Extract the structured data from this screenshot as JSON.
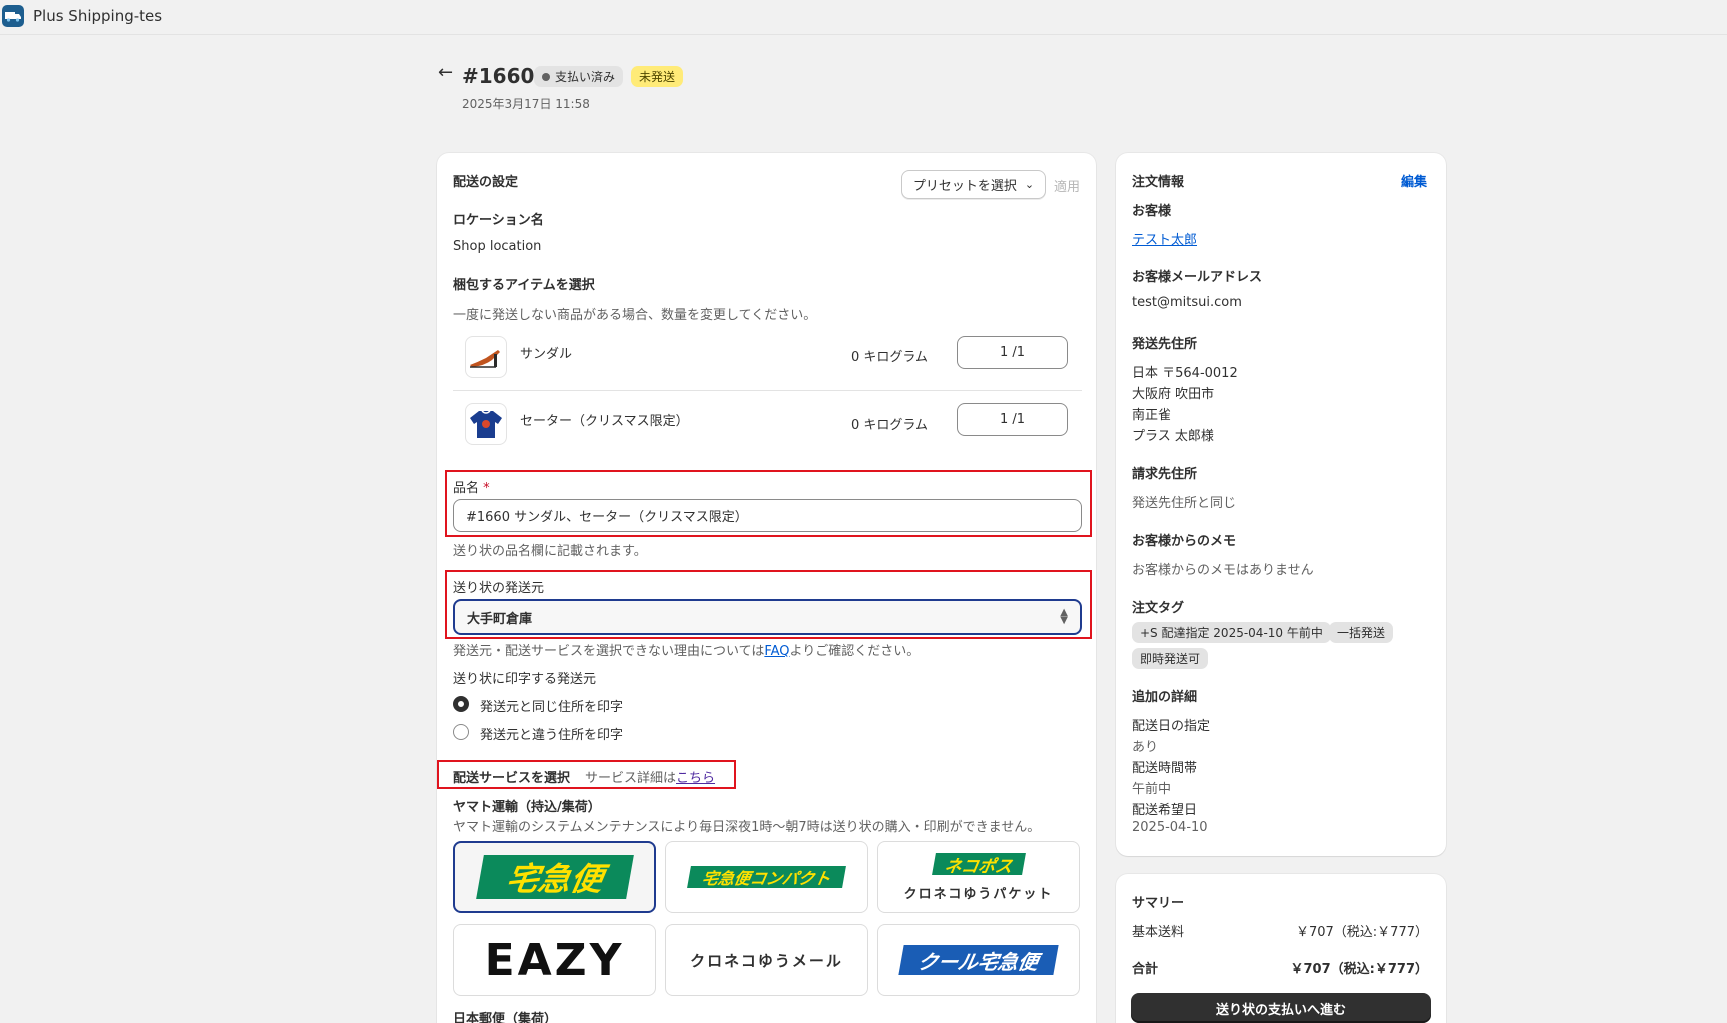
{
  "app": {
    "name": "Plus Shipping-tes"
  },
  "header": {
    "order_number": "#1660",
    "status_paid": "支払い済み",
    "status_fulfillment": "未発送",
    "date": "2025年3月17日 11:58"
  },
  "shipping": {
    "title": "配送の設定",
    "preset_label": "プリセットを選択",
    "apply_label": "適用",
    "location_heading": "ロケーション名",
    "location_value": "Shop location",
    "items_heading": "梱包するアイテムを選択",
    "items_help": "一度に発送しない商品がある場合、数量を変更してください。",
    "items": [
      {
        "name": "サンダル",
        "weight": "0 キログラム",
        "qty": "1 /1"
      },
      {
        "name": "セーター（クリスマス限定）",
        "weight": "0 キログラム",
        "qty": "1 /1"
      }
    ],
    "product_name_label": "品名",
    "product_name_required": "*",
    "product_name_value": "#1660 サンダル、セーター（クリスマス限定）",
    "product_name_help": "送り状の品名欄に記載されます。",
    "origin_label": "送り状の発送元",
    "origin_value": "大手町倉庫",
    "origin_help_before": "発送元・配送サービスを選択できない理由については",
    "origin_help_link": "FAQ",
    "origin_help_after": "よりご確認ください。",
    "print_origin_heading": "送り状に印字する発送元",
    "print_origin_options": [
      "発送元と同じ住所を印字",
      "発送元と違う住所を印字"
    ],
    "service_heading": "配送サービスを選択",
    "service_detail_text": "サービス詳細は",
    "service_detail_link": "こちら",
    "yamato_heading": "ヤマト運輸（持込/集荷）",
    "yamato_notice": "ヤマト運輸のシステムメンテナンスにより毎日深夜1時〜朝7時は送り状の購入・印刷ができません。",
    "services": {
      "takkyubin": "宅急便",
      "compact": "宅急便コンパクト",
      "nekopos": "ネコポス",
      "nekopos_sub": "クロネコゆうパケット",
      "eazy": "EAZY",
      "yu_mail": "クロネコゆうメール",
      "cool": "クール宅急便"
    },
    "japanpost_heading": "日本郵便（集荷）"
  },
  "order_info": {
    "title": "注文情報",
    "edit_label": "編集",
    "customer_heading": "お客様",
    "customer_name": "テスト太郎",
    "email_heading": "お客様メールアドレス",
    "email": "test@mitsui.com",
    "ship_address_heading": "発送先住所",
    "ship_address": [
      "日本 〒564-0012",
      "大阪府 吹田市",
      "南正雀",
      "プラス 太郎様"
    ],
    "billing_heading": "請求先住所",
    "billing_value": "発送先住所と同じ",
    "memo_heading": "お客様からのメモ",
    "memo_value": "お客様からのメモはありません",
    "tags_heading": "注文タグ",
    "tags": [
      "+S 配達指定 2025-04-10 午前中",
      "一括発送",
      "即時発送可"
    ],
    "details_heading": "追加の詳細",
    "details": [
      {
        "label": "配送日の指定",
        "value": "あり"
      },
      {
        "label": "配送時間帯",
        "value": "午前中"
      },
      {
        "label": "配送希望日",
        "value": "2025-04-10"
      }
    ]
  },
  "summary": {
    "title": "サマリー",
    "base_label": "基本送料",
    "base_value": "￥707（税込:￥777）",
    "total_label": "合計",
    "total_value": "￥707（税込:￥777）",
    "pay_button": "送り状の支払いへ進む"
  },
  "colors": {
    "highlight": "#e0141e",
    "link": "#005bd3",
    "selected_border": "#1f3b8f"
  }
}
